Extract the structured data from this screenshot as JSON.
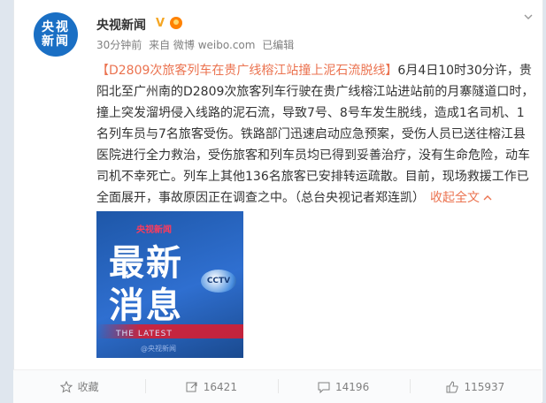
{
  "post": {
    "avatar_line1": "央视",
    "avatar_line2": "新闻",
    "username": "央视新闻",
    "verified_mark": "V",
    "meta_time": "30分钟前",
    "meta_from": "来自 微博 weibo.com",
    "meta_edited": "已编辑",
    "hashtag": "【D2809次旅客列车在贵广线榕江站撞上泥石流脱线】",
    "body": "6月4日10时30分许，贵阳北至广州南的D2809次旅客列车行驶在贵广线榕江站进站前的月寨隧道口时，撞上突发溜坍侵入线路的泥石流，导致7号、8号车发生脱线，造成1名司机、1名列车员与7名旅客受伤。铁路部门迅速启动应急预案，受伤人员已送往榕江县医院进行全力救治，受伤旅客和列车员均已得到妥善治疗，没有生命危险，动车司机不幸死亡。列车上其他136名旅客已安排转运疏散。目前，现场救援工作已全面展开，事故原因正在调查之中。（总台央视记者郑连凯）",
    "expand_label": "收起全文",
    "expand_icon": "chevron-up-icon",
    "image": {
      "top_logo": "央视新闻",
      "line1": "最新",
      "line2": "消息",
      "latest": "THE LATEST",
      "cctv": "CCTV",
      "watermark": "@央视新闻"
    }
  },
  "actions": {
    "favorite": {
      "label": "收藏",
      "icon": "star-icon"
    },
    "repost": {
      "label": "16421",
      "icon": "repost-icon"
    },
    "comment": {
      "label": "14196",
      "icon": "comment-icon"
    },
    "like": {
      "label": "115937",
      "icon": "thumbs-up-icon"
    }
  },
  "colors": {
    "link": "#eb7350",
    "meta": "#808080",
    "text": "#333333",
    "avatar_bg": "#1a6fc4"
  }
}
